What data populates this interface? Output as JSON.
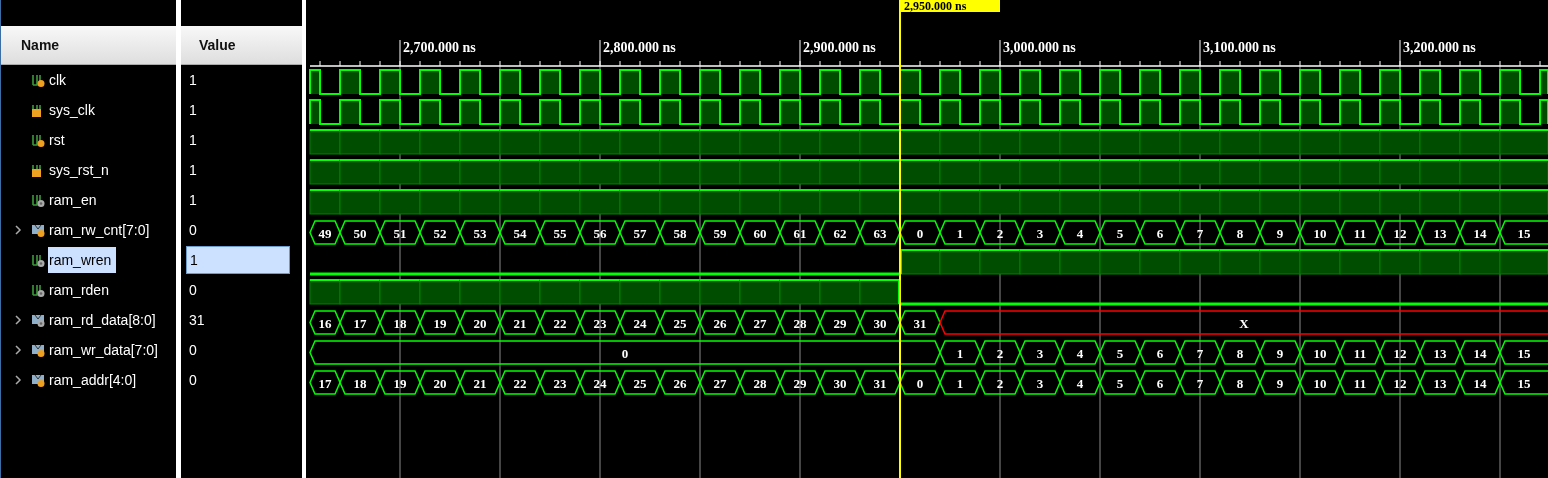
{
  "columns": {
    "name": "Name",
    "value": "Value"
  },
  "signals": [
    {
      "name": "clk",
      "value": "1",
      "kind": "clock",
      "selected": false
    },
    {
      "name": "sys_clk",
      "value": "1",
      "kind": "clock",
      "selected": false
    },
    {
      "name": "rst",
      "value": "1",
      "kind": "bit",
      "selected": false,
      "segments": [
        {
          "high": true
        },
        {
          "high": true
        },
        {
          "high": true
        },
        {
          "high": true
        },
        {
          "high": true
        },
        {
          "high": true
        },
        {
          "high": true
        },
        {
          "high": true
        },
        {
          "high": true
        },
        {
          "high": true
        },
        {
          "high": true
        },
        {
          "high": true
        },
        {
          "high": true
        },
        {
          "high": true
        },
        {
          "high": true
        },
        {
          "high": true
        },
        {
          "high": true
        },
        {
          "high": true
        },
        {
          "high": true
        },
        {
          "high": true
        },
        {
          "high": true
        },
        {
          "high": true
        },
        {
          "high": true
        },
        {
          "high": true
        },
        {
          "high": true
        },
        {
          "high": true
        },
        {
          "high": true
        },
        {
          "high": true
        },
        {
          "high": true
        },
        {
          "high": true
        },
        {
          "high": true
        }
      ]
    },
    {
      "name": "sys_rst_n",
      "value": "1",
      "kind": "bit",
      "selected": false,
      "segments": [
        {
          "high": true
        },
        {
          "high": true
        },
        {
          "high": true
        },
        {
          "high": true
        },
        {
          "high": true
        },
        {
          "high": true
        },
        {
          "high": true
        },
        {
          "high": true
        },
        {
          "high": true
        },
        {
          "high": true
        },
        {
          "high": true
        },
        {
          "high": true
        },
        {
          "high": true
        },
        {
          "high": true
        },
        {
          "high": true
        },
        {
          "high": true
        },
        {
          "high": true
        },
        {
          "high": true
        },
        {
          "high": true
        },
        {
          "high": true
        },
        {
          "high": true
        },
        {
          "high": true
        },
        {
          "high": true
        },
        {
          "high": true
        },
        {
          "high": true
        },
        {
          "high": true
        },
        {
          "high": true
        },
        {
          "high": true
        },
        {
          "high": true
        },
        {
          "high": true
        },
        {
          "high": true
        }
      ]
    },
    {
      "name": "ram_en",
      "value": "1",
      "kind": "bit",
      "selected": false,
      "segments": [
        {
          "high": true
        },
        {
          "high": true
        },
        {
          "high": true
        },
        {
          "high": true
        },
        {
          "high": true
        },
        {
          "high": true
        },
        {
          "high": true
        },
        {
          "high": true
        },
        {
          "high": true
        },
        {
          "high": true
        },
        {
          "high": true
        },
        {
          "high": true
        },
        {
          "high": true
        },
        {
          "high": true
        },
        {
          "high": true
        },
        {
          "high": true
        },
        {
          "high": true
        },
        {
          "high": true
        },
        {
          "high": true
        },
        {
          "high": true
        },
        {
          "high": true
        },
        {
          "high": true
        },
        {
          "high": true
        },
        {
          "high": true
        },
        {
          "high": true
        },
        {
          "high": true
        },
        {
          "high": true
        },
        {
          "high": true
        },
        {
          "high": true
        },
        {
          "high": true
        },
        {
          "high": true
        }
      ]
    },
    {
      "name": "ram_rw_cnt[7:0]",
      "value": "0",
      "kind": "bus",
      "selected": false,
      "expanded": false,
      "segments": [
        {
          "label": "49"
        },
        {
          "label": "50"
        },
        {
          "label": "51"
        },
        {
          "label": "52"
        },
        {
          "label": "53"
        },
        {
          "label": "54"
        },
        {
          "label": "55"
        },
        {
          "label": "56"
        },
        {
          "label": "57"
        },
        {
          "label": "58"
        },
        {
          "label": "59"
        },
        {
          "label": "60"
        },
        {
          "label": "61"
        },
        {
          "label": "62"
        },
        {
          "label": "63"
        },
        {
          "label": "0"
        },
        {
          "label": "1"
        },
        {
          "label": "2"
        },
        {
          "label": "3"
        },
        {
          "label": "4"
        },
        {
          "label": "5"
        },
        {
          "label": "6"
        },
        {
          "label": "7"
        },
        {
          "label": "8"
        },
        {
          "label": "9"
        },
        {
          "label": "10"
        },
        {
          "label": "11"
        },
        {
          "label": "12"
        },
        {
          "label": "13"
        },
        {
          "label": "14"
        },
        {
          "label": "15"
        }
      ]
    },
    {
      "name": "ram_wren",
      "value": "1",
      "kind": "bit",
      "selected": true,
      "segments": [
        {
          "high": false
        },
        {
          "high": false
        },
        {
          "high": false
        },
        {
          "high": false
        },
        {
          "high": false
        },
        {
          "high": false
        },
        {
          "high": false
        },
        {
          "high": false
        },
        {
          "high": false
        },
        {
          "high": false
        },
        {
          "high": false
        },
        {
          "high": false
        },
        {
          "high": false
        },
        {
          "high": false
        },
        {
          "high": false
        },
        {
          "high": true
        },
        {
          "high": true
        },
        {
          "high": true
        },
        {
          "high": true
        },
        {
          "high": true
        },
        {
          "high": true
        },
        {
          "high": true
        },
        {
          "high": true
        },
        {
          "high": true
        },
        {
          "high": true
        },
        {
          "high": true
        },
        {
          "high": true
        },
        {
          "high": true
        },
        {
          "high": true
        },
        {
          "high": true
        },
        {
          "high": true
        }
      ]
    },
    {
      "name": "ram_rden",
      "value": "0",
      "kind": "bit",
      "selected": false,
      "segments": [
        {
          "high": true
        },
        {
          "high": true
        },
        {
          "high": true
        },
        {
          "high": true
        },
        {
          "high": true
        },
        {
          "high": true
        },
        {
          "high": true
        },
        {
          "high": true
        },
        {
          "high": true
        },
        {
          "high": true
        },
        {
          "high": true
        },
        {
          "high": true
        },
        {
          "high": true
        },
        {
          "high": true
        },
        {
          "high": true
        },
        {
          "high": false
        },
        {
          "high": false
        },
        {
          "high": false
        },
        {
          "high": false
        },
        {
          "high": false
        },
        {
          "high": false
        },
        {
          "high": false
        },
        {
          "high": false
        },
        {
          "high": false
        },
        {
          "high": false
        },
        {
          "high": false
        },
        {
          "high": false
        },
        {
          "high": false
        },
        {
          "high": false
        },
        {
          "high": false
        },
        {
          "high": false
        }
      ]
    },
    {
      "name": "ram_rd_data[8:0]",
      "value": "31",
      "kind": "bus",
      "selected": false,
      "expanded": false,
      "segments": [
        {
          "label": "16"
        },
        {
          "label": "17"
        },
        {
          "label": "18"
        },
        {
          "label": "19"
        },
        {
          "label": "20"
        },
        {
          "label": "21"
        },
        {
          "label": "22"
        },
        {
          "label": "23"
        },
        {
          "label": "24"
        },
        {
          "label": "25"
        },
        {
          "label": "26"
        },
        {
          "label": "27"
        },
        {
          "label": "28"
        },
        {
          "label": "29"
        },
        {
          "label": "30"
        },
        {
          "label": "31"
        },
        {
          "label": "X",
          "unknown": true
        }
      ]
    },
    {
      "name": "ram_wr_data[7:0]",
      "value": "0",
      "kind": "bus",
      "selected": false,
      "expanded": false,
      "segments": [
        {
          "label": "0"
        },
        {
          "held": true
        },
        {
          "held": true
        },
        {
          "held": true
        },
        {
          "held": true
        },
        {
          "held": true
        },
        {
          "held": true
        },
        {
          "held": true
        },
        {
          "held": true
        },
        {
          "held": true
        },
        {
          "held": true
        },
        {
          "held": true
        },
        {
          "held": true
        },
        {
          "held": true
        },
        {
          "held": true
        },
        {
          "held": true
        },
        {
          "label": "1"
        },
        {
          "label": "2"
        },
        {
          "label": "3"
        },
        {
          "label": "4"
        },
        {
          "label": "5"
        },
        {
          "label": "6"
        },
        {
          "label": "7"
        },
        {
          "label": "8"
        },
        {
          "label": "9"
        },
        {
          "label": "10"
        },
        {
          "label": "11"
        },
        {
          "label": "12"
        },
        {
          "label": "13"
        },
        {
          "label": "14"
        },
        {
          "label": "15"
        }
      ]
    },
    {
      "name": "ram_addr[4:0]",
      "value": "0",
      "kind": "bus",
      "selected": false,
      "expanded": false,
      "segments": [
        {
          "label": "17"
        },
        {
          "label": "18"
        },
        {
          "label": "19"
        },
        {
          "label": "20"
        },
        {
          "label": "21"
        },
        {
          "label": "22"
        },
        {
          "label": "23"
        },
        {
          "label": "24"
        },
        {
          "label": "25"
        },
        {
          "label": "26"
        },
        {
          "label": "27"
        },
        {
          "label": "28"
        },
        {
          "label": "29"
        },
        {
          "label": "30"
        },
        {
          "label": "31"
        },
        {
          "label": "0"
        },
        {
          "label": "1"
        },
        {
          "label": "2"
        },
        {
          "label": "3"
        },
        {
          "label": "4"
        },
        {
          "label": "5"
        },
        {
          "label": "6"
        },
        {
          "label": "7"
        },
        {
          "label": "8"
        },
        {
          "label": "9"
        },
        {
          "label": "10"
        },
        {
          "label": "11"
        },
        {
          "label": "12"
        },
        {
          "label": "13"
        },
        {
          "label": "14"
        },
        {
          "label": "15"
        }
      ]
    }
  ],
  "ruler": {
    "labels": [
      "2,700.000 ns",
      "2,800.000 ns",
      "2,900.000 ns",
      "3,000.000 ns",
      "3,100.000 ns",
      "3,200.000 ns"
    ]
  },
  "cursor": {
    "time": "2,950.000 ns"
  }
}
